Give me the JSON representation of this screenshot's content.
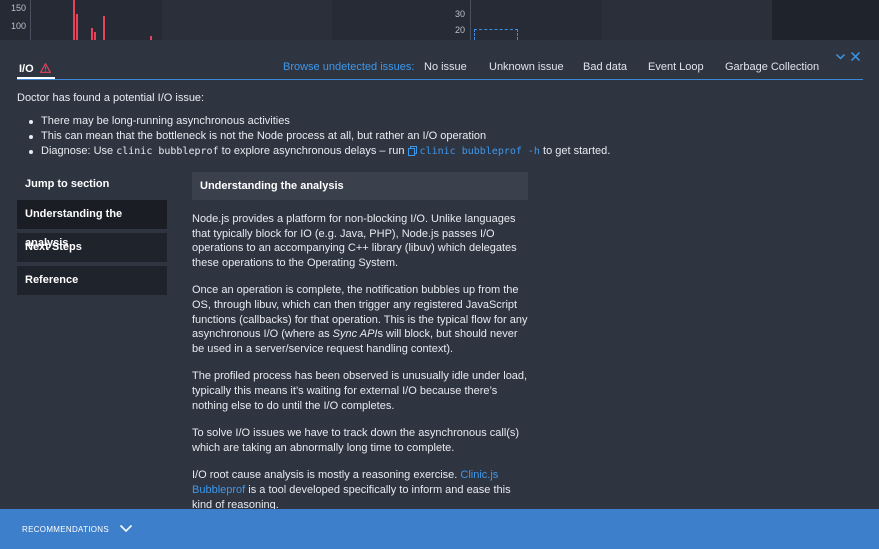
{
  "chart_strip": {
    "left_ticks": [
      "150",
      "100"
    ],
    "right_ticks": [
      "30",
      "20"
    ]
  },
  "tabs": {
    "active_label": "I/O",
    "browse_label": "Browse undetected issues:",
    "issues": [
      "No issue",
      "Unknown issue",
      "Bad data",
      "Event Loop",
      "Garbage Collection"
    ]
  },
  "icons": {
    "warning": "warning-triangle-icon",
    "collapse": "chevron-down-icon",
    "close": "close-icon",
    "copy": "copy-icon",
    "footer_toggle": "chevron-down-icon"
  },
  "summary": {
    "lead": "Doctor has found a potential I/O issue:",
    "bullet_1": "There may be long-running asynchronous activities",
    "bullet_2": "This can mean that the bottleneck is not the Node process at all, but rather an I/O operation",
    "bullet_3_prefix": "Diagnose: Use",
    "bullet_3_code": "clinic bubbleprof",
    "bullet_3_middle": "to explore asynchronous delays – run",
    "bullet_3_cmd": "clinic bubbleprof -h",
    "bullet_3_suffix": "to get started."
  },
  "nav": {
    "title": "Jump to section",
    "items": [
      "Understanding the analysis",
      "Next Steps",
      "Reference"
    ]
  },
  "content": {
    "heading": "Understanding the analysis",
    "p1": "Node.js provides a platform for non-blocking I/O. Unlike languages that typically block for IO (e.g. Java, PHP), Node.js passes I/O operations to an accompanying C++ library (libuv) which delegates these operations to the Operating System.",
    "p2_before": "Once an operation is complete, the notification bubbles up from the OS, through libuv, which can then trigger any registered JavaScript functions (callbacks) for that operation. This is the typical flow for any asynchronous I/O (where as",
    "p2_em": "Sync API",
    "p2_after": "s will block, but should never be used in a server/service request handling context).",
    "p3": "The profiled process has been observed is unusually idle under load, typically this means it’s waiting for external I/O because there’s nothing else to do until the I/O completes.",
    "p4": "To solve I/O issues we have to track down the asynchronous call(s) which are taking an abnormally long time to complete.",
    "p5_before": "I/O root cause analysis is mostly a reasoning exercise.",
    "p5_link": "Clinic.js Bubbleprof",
    "p5_after": "is a tool developed specifically to inform and ease this kind of reasoning."
  },
  "footer": {
    "label": "RECOMMENDATIONS"
  },
  "colors": {
    "accent": "#3e98ea",
    "warning": "#e6435a",
    "footer": "#3d7fca"
  }
}
